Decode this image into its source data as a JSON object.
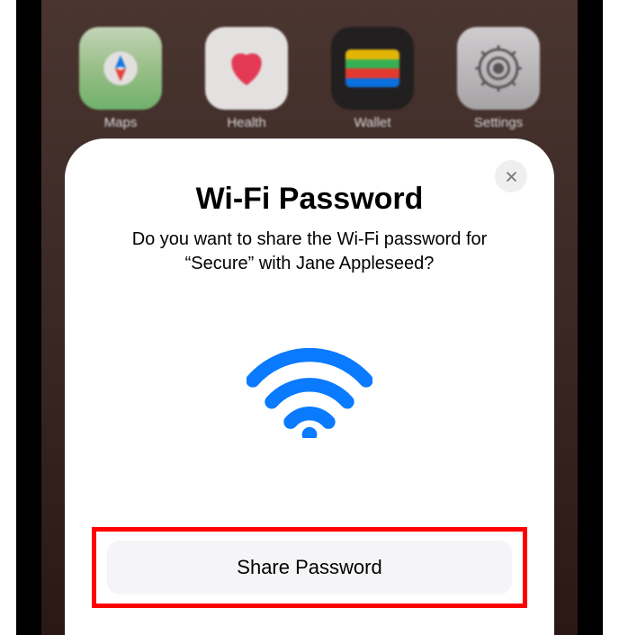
{
  "home": {
    "apps": [
      {
        "label": "Maps"
      },
      {
        "label": "Health"
      },
      {
        "label": "Wallet"
      },
      {
        "label": "Settings"
      }
    ]
  },
  "modal": {
    "title": "Wi-Fi Password",
    "subtitle": "Do you want to share the Wi-Fi password for “Secure” with Jane Appleseed?",
    "share_button": "Share Password"
  }
}
